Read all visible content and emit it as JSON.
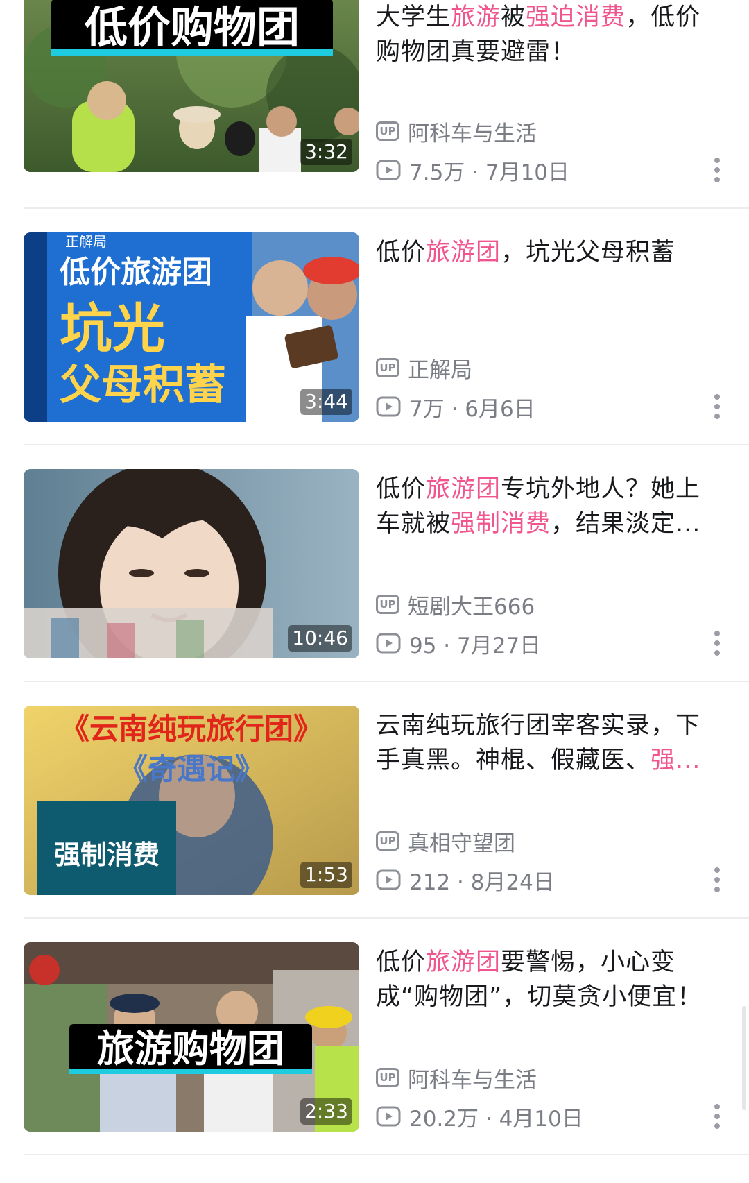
{
  "colors": {
    "highlight": "#f0568d",
    "text": "#18191c",
    "meta": "#7a7d84",
    "divider": "#ececec"
  },
  "icons": {
    "uploader": "up-badge-icon",
    "views": "play-icon",
    "more": "more-vertical-icon"
  },
  "videos": [
    {
      "thumbnail_text": "低价购物团",
      "duration": "3:32",
      "title_parts": [
        {
          "text": "大学生",
          "hl": false
        },
        {
          "text": "旅游",
          "hl": true
        },
        {
          "text": "被",
          "hl": false
        },
        {
          "text": "强迫消费",
          "hl": true
        },
        {
          "text": "，低价购物团真要避雷！",
          "hl": false
        }
      ],
      "up_badge": "UP",
      "uploader": "阿科车与生活",
      "stats": "7.5万 · 7月10日"
    },
    {
      "thumbnail_text": "低价旅游团 坑光 父母积蓄",
      "thumbnail_text_lines": [
        "正解局",
        "低价旅游团",
        "坑光",
        "父母积蓄"
      ],
      "duration": "3:44",
      "title_parts": [
        {
          "text": "低价",
          "hl": false
        },
        {
          "text": "旅游团",
          "hl": true
        },
        {
          "text": "，坑光父母积蓄",
          "hl": false
        }
      ],
      "up_badge": "UP",
      "uploader": "正解局",
      "stats": "7万 · 6月6日"
    },
    {
      "thumbnail_text": "",
      "duration": "10:46",
      "title_parts": [
        {
          "text": "低价",
          "hl": false
        },
        {
          "text": "旅游团",
          "hl": true
        },
        {
          "text": "专坑外地人？她上车就被",
          "hl": false
        },
        {
          "text": "强制消费",
          "hl": true
        },
        {
          "text": "，结果淡定...",
          "hl": false
        }
      ],
      "up_badge": "UP",
      "uploader": "短剧大王666",
      "stats": "95 · 7月27日"
    },
    {
      "thumbnail_text": "《云南纯玩旅行团》《奇遇记》强制消费",
      "thumbnail_text_lines": [
        "《云南纯玩旅行团》",
        "《奇遇记》",
        "强制消费"
      ],
      "duration": "1:53",
      "title_parts": [
        {
          "text": "云南纯玩旅行团宰客实录，下手真黑。神棍、假藏医、",
          "hl": false
        },
        {
          "text": "强...",
          "hl": true
        }
      ],
      "up_badge": "UP",
      "uploader": "真相守望团",
      "stats": "212 · 8月24日"
    },
    {
      "thumbnail_text": "旅游购物团",
      "duration": "2:33",
      "title_parts": [
        {
          "text": "低价",
          "hl": false
        },
        {
          "text": "旅游团",
          "hl": true
        },
        {
          "text": "要警惕，小心变成“购物团”，切莫贪小便宜！",
          "hl": false
        }
      ],
      "up_badge": "UP",
      "uploader": "阿科车与生活",
      "stats": "20.2万 · 4月10日"
    }
  ]
}
